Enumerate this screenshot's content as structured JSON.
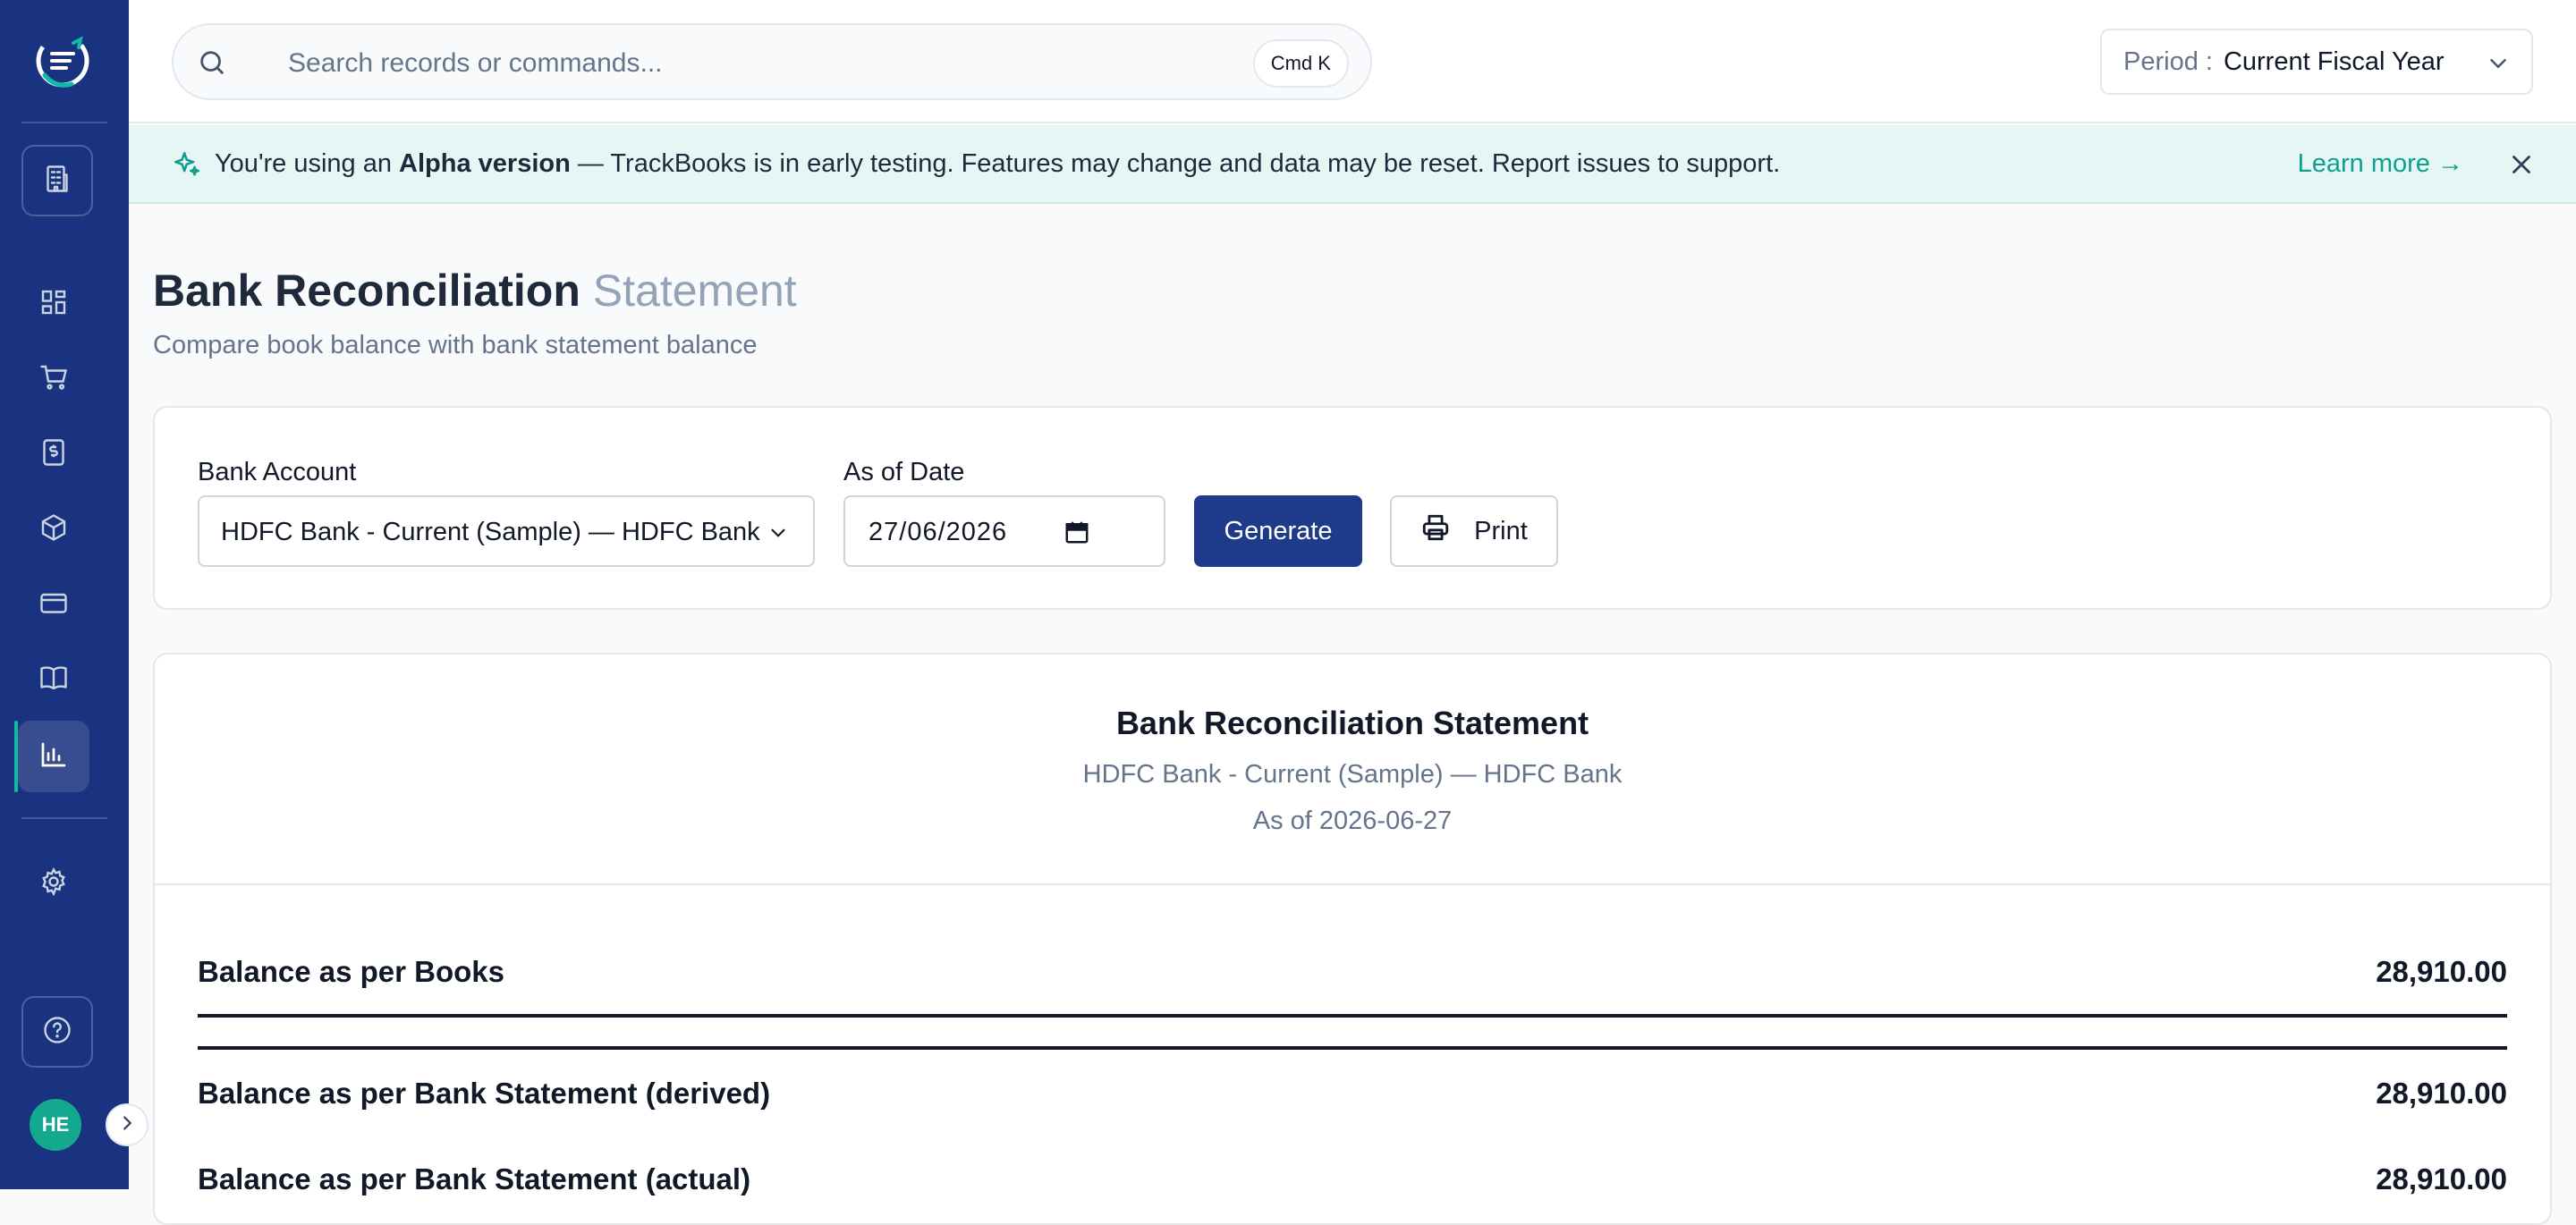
{
  "sidebar": {
    "avatar_initials": "HE",
    "icons": [
      "company-icon",
      "dashboard-icon",
      "cart-icon",
      "invoice-icon",
      "inventory-icon",
      "card-icon",
      "book-icon",
      "reports-icon",
      "settings-icon",
      "help-icon",
      "expand-icon"
    ]
  },
  "search": {
    "placeholder": "Search records or commands...",
    "shortcut": "Cmd K"
  },
  "period": {
    "label": "Period :",
    "value": "Current Fiscal Year"
  },
  "banner": {
    "prefix": "You're using an",
    "highlight": "Alpha version",
    "suffix": "— TrackBooks is in early testing. Features may change and data may be reset. Report issues to support.",
    "learn_more": "Learn more →"
  },
  "page": {
    "title": "Bank Reconciliation",
    "title_sub": "Statement",
    "description": "Compare book balance with bank statement balance"
  },
  "filters": {
    "bank_account_label": "Bank Account",
    "bank_account_value": "HDFC Bank - Current (Sample) — HDFC Bank",
    "as_of_label": "As of Date",
    "as_of_value": "27/06/2026",
    "generate_label": "Generate",
    "print_label": "Print"
  },
  "report": {
    "title": "Bank Reconciliation Statement",
    "account": "HDFC Bank - Current (Sample) — HDFC Bank",
    "as_of": "As of 2026-06-27",
    "rows": [
      {
        "label": "Balance as per Books",
        "value": "28,910.00"
      },
      {
        "label": "Balance as per Bank Statement (derived)",
        "value": "28,910.00"
      },
      {
        "label": "Balance as per Bank Statement (actual)",
        "value": "28,910.00"
      }
    ]
  },
  "colors": {
    "sidebar": "#1a3380",
    "accent": "#14b8a6",
    "primary_button": "#1e3a8a",
    "banner_bg": "#e6f6f4"
  }
}
